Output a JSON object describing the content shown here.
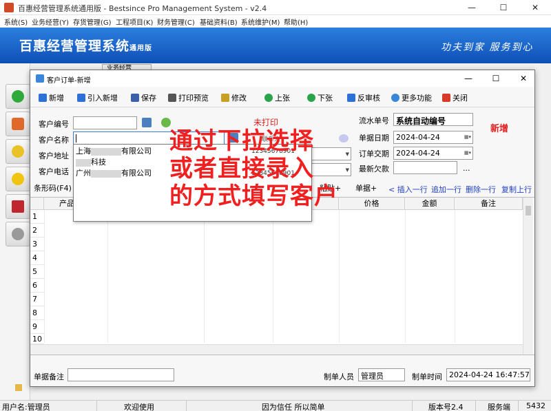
{
  "window": {
    "title": "百惠经营管理系统通用版 - Bestsince Pro Management System - v2.4",
    "min_icon": "minimize-icon",
    "max_icon": "maximize-icon",
    "close_icon": "close-icon",
    "min_glyph": "—",
    "max_glyph": "☐",
    "close_glyph": "✕"
  },
  "menu": [
    "系统(S)",
    "业务经营(Y)",
    "存货管理(G)",
    "工程项目(K)",
    "财务管理(C)",
    "基础资料(B)",
    "系统维护(M)",
    "帮助(H)"
  ],
  "banner": {
    "title": "百惠经营管理系统",
    "edition": "通用版",
    "slogan": "功夫到家 服务到心"
  },
  "behind_tab": "业务经营",
  "dialog": {
    "title": "客户订单-新增",
    "controls": {
      "min": "—",
      "max": "☐",
      "close": "✕"
    },
    "toolbar": [
      {
        "label": "新增",
        "icon": "plus-icon",
        "color": "#2f6fd6"
      },
      {
        "label": "引入新增",
        "icon": "plus-icon",
        "color": "#2f6fd6"
      },
      {
        "label": "保存",
        "icon": "save-icon",
        "color": "#3b5fa8"
      },
      {
        "label": "打印预览",
        "icon": "printer-icon",
        "color": "#555555"
      },
      {
        "label": "修改",
        "icon": "edit-icon",
        "color": "#c8a022"
      },
      {
        "label": "上张",
        "icon": "arrow-up-icon",
        "color": "#2aa34a"
      },
      {
        "label": "下张",
        "icon": "arrow-down-icon",
        "color": "#2aa34a"
      },
      {
        "label": "反审核",
        "icon": "unaudit-icon",
        "color": "#2f6fd6"
      },
      {
        "label": "更多功能",
        "icon": "gear-icon",
        "color": "#3a86d8"
      },
      {
        "label": "关闭",
        "icon": "close-box-icon",
        "color": "#d83a2a"
      }
    ],
    "form": {
      "customer_no_label": "客户编号",
      "customer_name_label": "客户名称",
      "customer_addr_label": "客户地址",
      "customer_phone_label": "客户电话",
      "print_status": "未打印",
      "serial_label": "流水单号",
      "serial_value": "系统自动编号",
      "doc_date_label": "单据日期",
      "doc_date_value": "2024-04-24",
      "deliver_date_label": "订单交期",
      "deliver_date_value": "2024-04-24",
      "latest_debt_label": "最新欠款",
      "more_btn": "...",
      "mode_badge": "新增",
      "partial_label": "联系人",
      "partial_select": "",
      "partial_select2": ""
    },
    "grid_toolbar": {
      "barcode_label": "条形码(F4)",
      "paste": "粘贴+",
      "doc": "单据+",
      "insert_row": "< 插入一行",
      "append_row": "追加一行",
      "delete_row": "删除一行",
      "copy_row": "复制上行"
    },
    "grid": {
      "columns": [
        "产品",
        "价格",
        "金额",
        "备注"
      ],
      "rows": [
        "1",
        "2",
        "3",
        "4",
        "5",
        "6",
        "7",
        "8",
        "9",
        "10"
      ]
    },
    "footer": {
      "remark_label": "单据备注",
      "maker_label": "制单人员",
      "maker_value": "管理员",
      "time_label": "制单时间",
      "time_value": "2024-04-24 16:47:57"
    }
  },
  "dropdown": {
    "items": [
      {
        "prefix": "上海",
        "suffix": "有限公司",
        "phone": "12345678901"
      },
      {
        "prefix": "",
        "suffix": "科技",
        "phone": ""
      },
      {
        "prefix": "广州",
        "suffix": "有限公司",
        "phone": "12345678901"
      }
    ]
  },
  "annotation": [
    "通过下拉选择",
    "或者直接录入",
    "的方式填写客户"
  ],
  "statusbar": {
    "user": "用户名:管理员",
    "welcome": "欢迎使用",
    "motto": "因为信任 所以简单",
    "version": "版本号2.4",
    "server": "服务端",
    "port": "5432"
  }
}
